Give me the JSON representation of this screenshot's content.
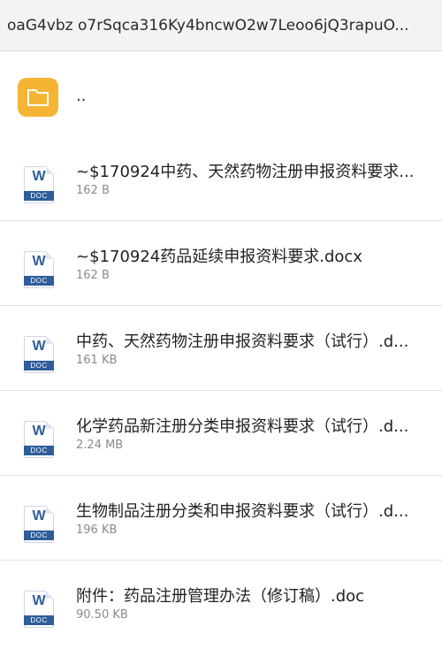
{
  "header": {
    "path": "oaG4vbz o7rSqca316Ky4bncwO2w7Leoo6jQ3rapuO..."
  },
  "parent": {
    "label": "..",
    "icon": "folder-icon",
    "color": "#f5b534"
  },
  "doc_icon": {
    "letter": "W",
    "band": "DOC",
    "color": "#2f5d9a"
  },
  "files": [
    {
      "name": "~$170924中药、天然药物注册申报资料要求...",
      "size": "162 B"
    },
    {
      "name": "~$170924药品延续申报资料要求.docx",
      "size": "162 B"
    },
    {
      "name": "中药、天然药物注册申报资料要求（试行）.d...",
      "size": "161 KB"
    },
    {
      "name": "化学药品新注册分类申报资料要求（试行）.d...",
      "size": "2.24 MB"
    },
    {
      "name": "生物制品注册分类和申报资料要求（试行）.d...",
      "size": "196 KB"
    },
    {
      "name": "附件：药品注册管理办法（修订稿）.doc",
      "size": "90.50 KB"
    }
  ]
}
